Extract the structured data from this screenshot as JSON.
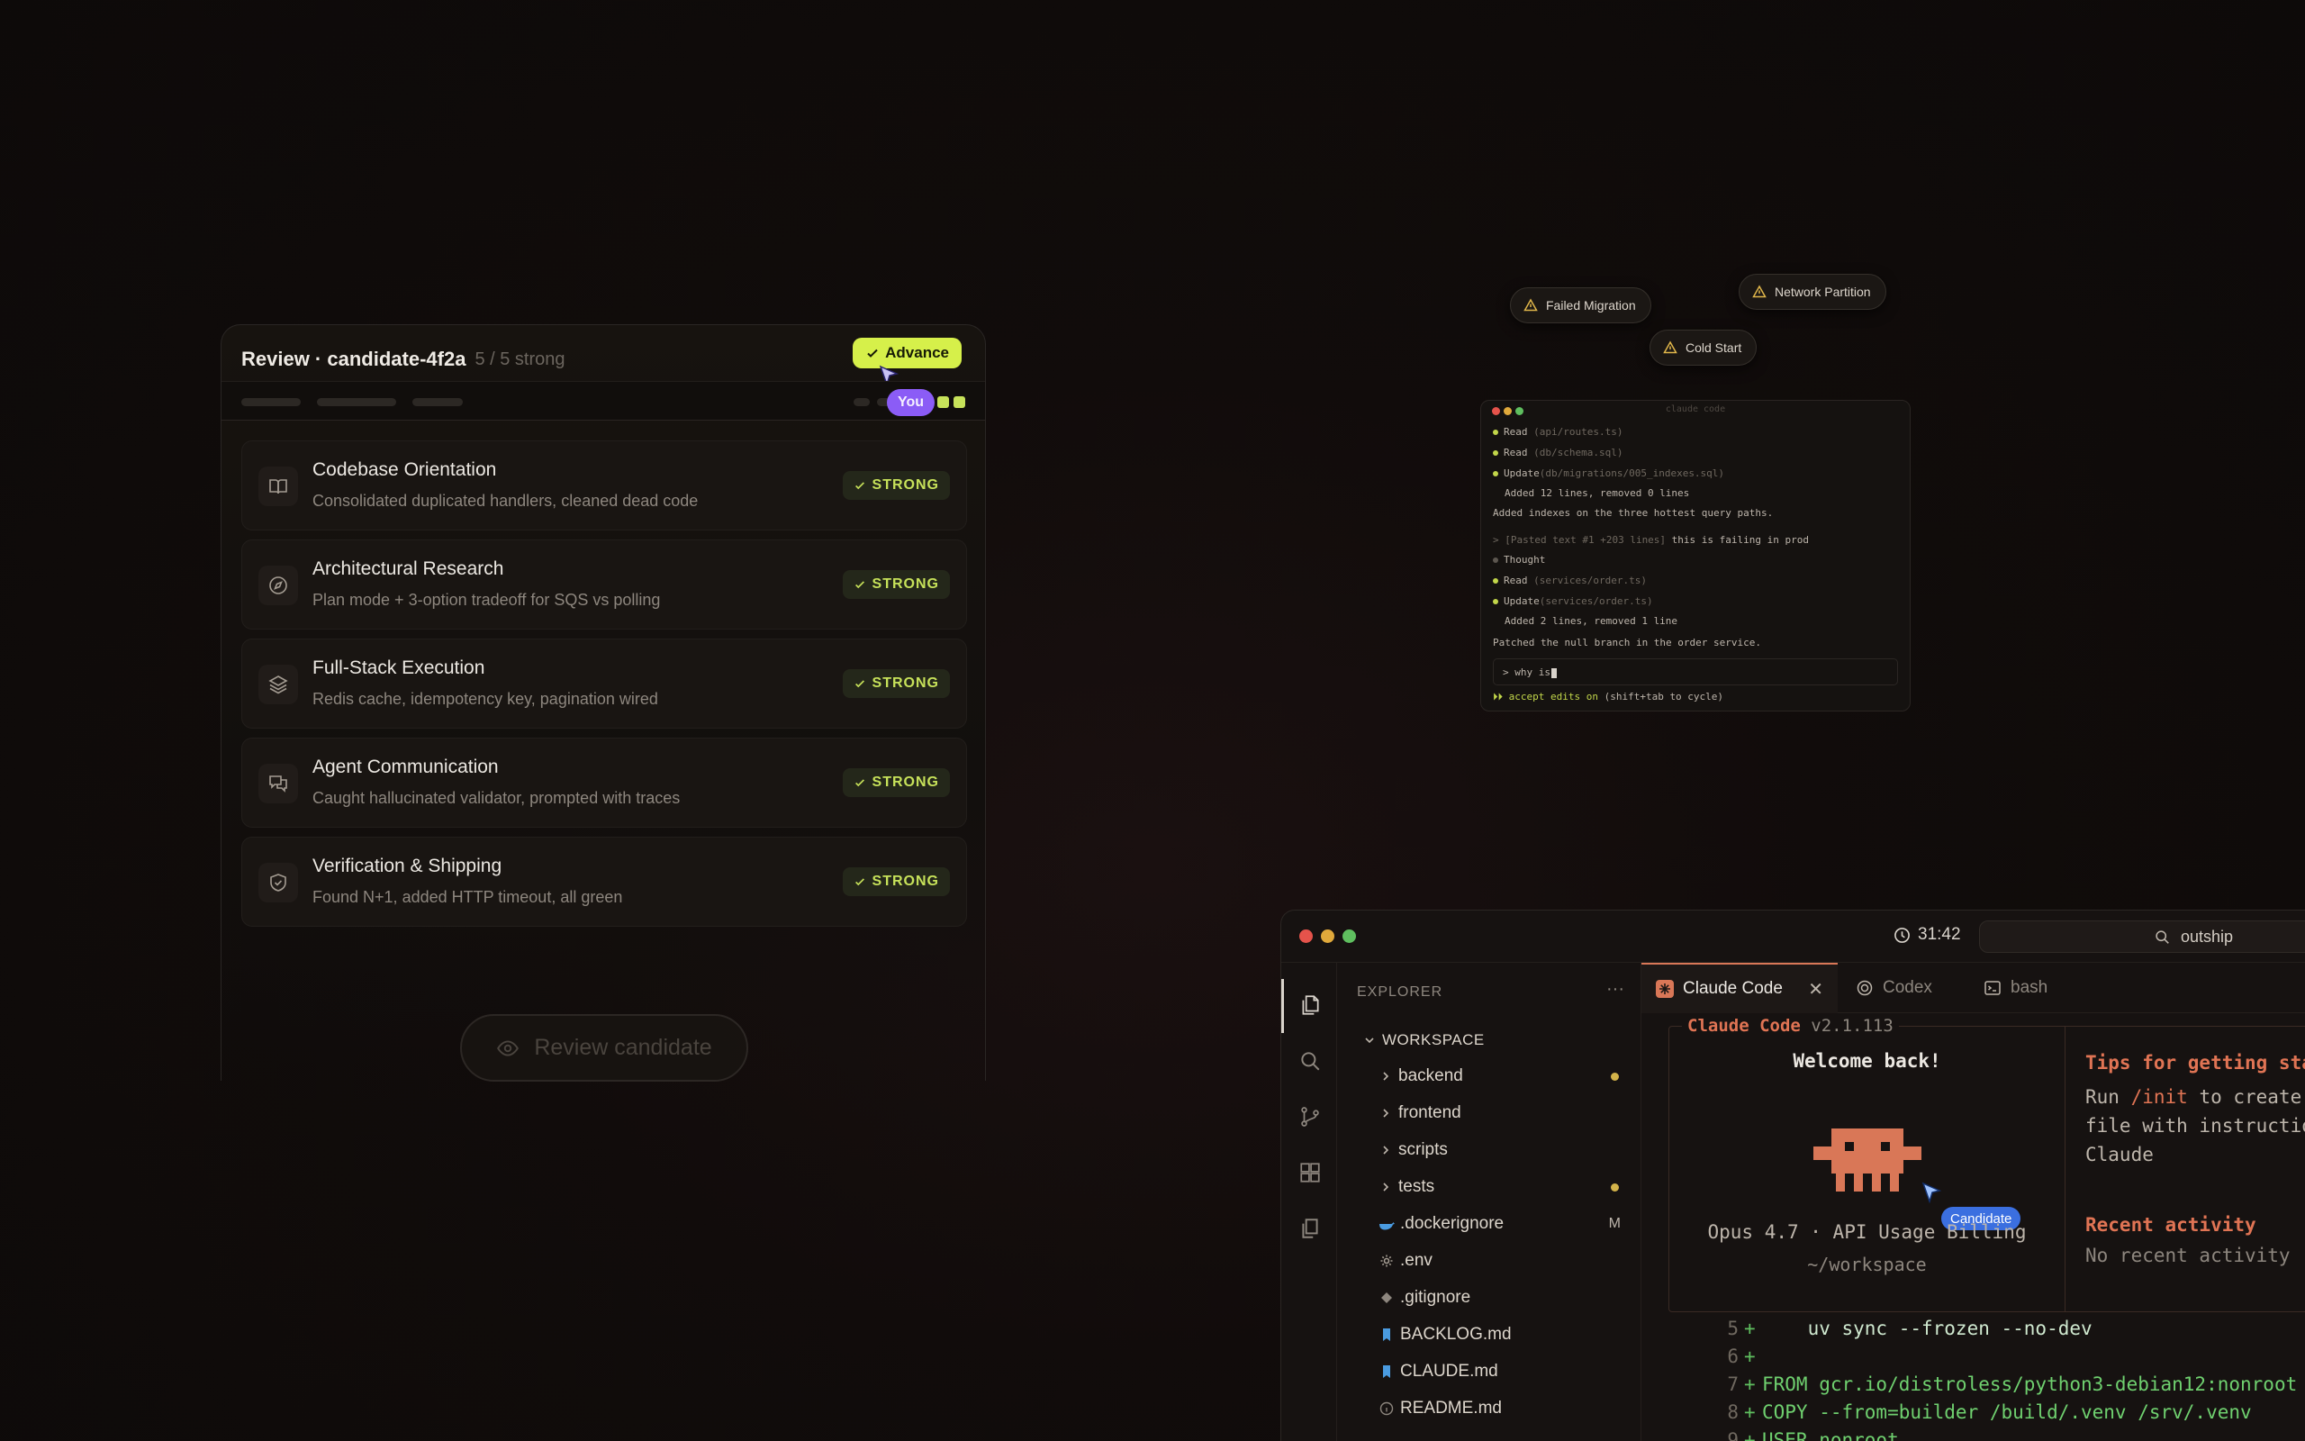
{
  "review": {
    "title": "Review · candidate-4f2a",
    "subtitle": "5 / 5 strong",
    "advance_label": "Advance",
    "you_label": "You",
    "items": [
      {
        "title": "Codebase Orientation",
        "desc": "Consolidated duplicated handlers, cleaned dead code",
        "badge": "STRONG",
        "icon": "book-icon"
      },
      {
        "title": "Architectural Research",
        "desc": "Plan mode + 3-option tradeoff for SQS vs polling",
        "badge": "STRONG",
        "icon": "compass-icon"
      },
      {
        "title": "Full-Stack Execution",
        "desc": "Redis cache, idempotency key, pagination wired",
        "badge": "STRONG",
        "icon": "layers-icon"
      },
      {
        "title": "Agent Communication",
        "desc": "Caught hallucinated validator, prompted with traces",
        "badge": "STRONG",
        "icon": "chat-icon"
      },
      {
        "title": "Verification & Shipping",
        "desc": "Found N+1, added HTTP timeout, all green",
        "badge": "STRONG",
        "icon": "shield-icon"
      }
    ],
    "review_button": "Review candidate"
  },
  "chips": {
    "failed_migration": "Failed Migration",
    "network_partition": "Network Partition",
    "cold_start": "Cold Start"
  },
  "miniterm": {
    "title": "claude code",
    "l1_cmd": "Read",
    "l1_arg": "(api/routes.ts)",
    "l2_cmd": "Read",
    "l2_arg": "(db/schema.sql)",
    "l3_cmd": "Update",
    "l3_arg": "(db/migrations/005_indexes.sql)",
    "l3_sub": "Added 12 lines, removed 0 lines",
    "l4": "Added indexes on the three hottest query paths.",
    "l5_dim": "> [Pasted text #1 +203 lines]",
    "l5_txt": " this is failing in prod",
    "l6": "Thought",
    "l7_cmd": "Read",
    "l7_arg": "(services/order.ts)",
    "l8_cmd": "Update",
    "l8_arg": "(services/order.ts)",
    "l8_sub": "Added 2 lines, removed 1 line",
    "l9": "Patched the null branch in the order service.",
    "input": "> why is",
    "footer_a": "⏵⏵ accept edits on",
    "footer_b": " (shift+tab to cycle)"
  },
  "ide": {
    "timer": "31:42",
    "search": "outship",
    "explorer_label": "EXPLORER",
    "workspace_label": "WORKSPACE",
    "tree": [
      {
        "name": "backend",
        "type": "folder",
        "mark": "dot"
      },
      {
        "name": "frontend",
        "type": "folder",
        "mark": ""
      },
      {
        "name": "scripts",
        "type": "folder",
        "mark": ""
      },
      {
        "name": "tests",
        "type": "folder",
        "mark": "dot"
      },
      {
        "name": ".dockerignore",
        "type": "docker",
        "mark": "M"
      },
      {
        "name": ".env",
        "type": "gear",
        "mark": ""
      },
      {
        "name": ".gitignore",
        "type": "git",
        "mark": ""
      },
      {
        "name": "BACKLOG.md",
        "type": "md",
        "mark": ""
      },
      {
        "name": "CLAUDE.md",
        "type": "md",
        "mark": ""
      },
      {
        "name": "README.md",
        "type": "info",
        "mark": ""
      }
    ],
    "tabs": [
      {
        "label": "Claude Code",
        "active": true
      },
      {
        "label": "Codex",
        "active": false
      },
      {
        "label": "bash",
        "active": false
      }
    ],
    "cc": {
      "name": "Claude Code",
      "version": " v2.1.113",
      "welcome": "Welcome back!",
      "model": "Opus 4.7 · API Usage Billing",
      "path": "~/workspace",
      "candidate_label": "Candidate",
      "tips_heading": "Tips for getting started",
      "tips_run": "Run ",
      "tips_cmd": "/init",
      "tips_rest1": " to create a CLAUDE.md",
      "tips_line2": "file with instructions for",
      "tips_line3": "Claude",
      "recent_heading": "Recent activity",
      "recent_body": "No recent activity"
    },
    "diff": [
      {
        "n": "5",
        "s": "+",
        "t": "    uv sync --frozen --no-dev"
      },
      {
        "n": "6",
        "s": "+",
        "t": ""
      },
      {
        "n": "7",
        "s": "+",
        "t": "FROM gcr.io/distroless/python3-debian12:nonroot"
      },
      {
        "n": "8",
        "s": "+",
        "t": "COPY --from=builder /build/.venv /srv/.venv"
      },
      {
        "n": "9",
        "s": "+",
        "t": "USER nonroot"
      }
    ]
  },
  "colors": {
    "accent_lime": "#d6f04a",
    "you_purple": "#8b5cf6",
    "claude_orange": "#e07454",
    "candidate_blue": "#3b6fe0"
  }
}
